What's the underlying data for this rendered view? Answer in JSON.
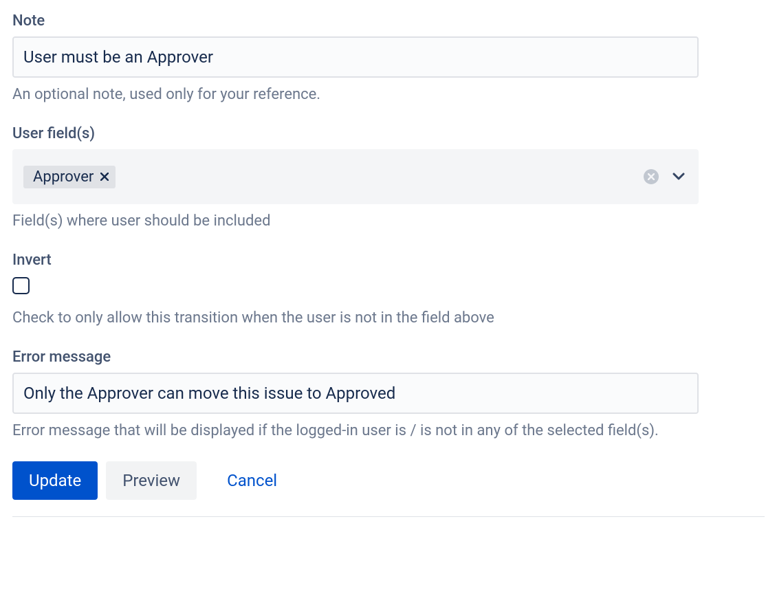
{
  "note": {
    "label": "Note",
    "value": "User must be an Approver",
    "help": "An optional note, used only for your reference."
  },
  "userFields": {
    "label": "User field(s)",
    "tags": [
      "Approver"
    ],
    "help": "Field(s) where user should be included"
  },
  "invert": {
    "label": "Invert",
    "checked": false,
    "help": "Check to only allow this transition when the user is not in the field above"
  },
  "errorMessage": {
    "label": "Error message",
    "value": "Only the Approver can move this issue to Approved",
    "help": "Error message that will be displayed if the logged-in user is / is not in any of the selected field(s)."
  },
  "buttons": {
    "update": "Update",
    "preview": "Preview",
    "cancel": "Cancel"
  }
}
